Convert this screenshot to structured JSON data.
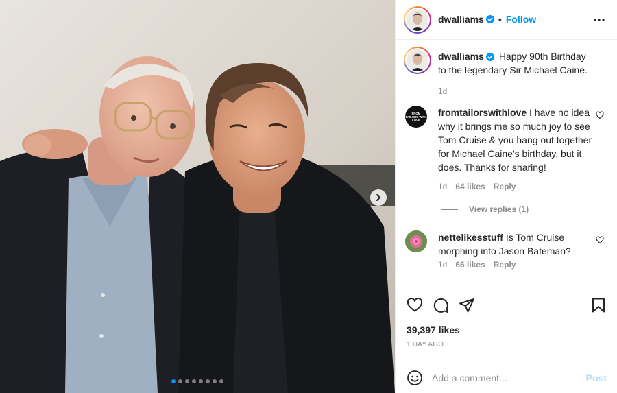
{
  "header": {
    "username": "dwalliams",
    "separator": "•",
    "follow_label": "Follow"
  },
  "caption": {
    "username": "dwalliams",
    "text": "Happy 90th Birthday to the legendary Sir Michael Caine.",
    "time": "1d"
  },
  "comments": [
    {
      "username": "fromtailorswithlove",
      "avatar_text": "FROM TAILORS WITH LOVE",
      "text": "I have no idea why it brings me so much joy to see Tom Cruise & you hang out together for Michael Caine's birthday, but it does. Thanks for sharing!",
      "time": "1d",
      "likes": "64 likes",
      "reply_label": "Reply",
      "view_replies": "View replies (1)"
    },
    {
      "username": "nettelikesstuff",
      "text": "Is Tom Cruise morphing into Jason Bateman?",
      "time": "1d",
      "likes": "66 likes",
      "reply_label": "Reply"
    }
  ],
  "stats": {
    "likes": "39,397 likes",
    "date": "1 DAY AGO"
  },
  "add_comment": {
    "placeholder": "Add a comment...",
    "post_label": "Post"
  },
  "carousel": {
    "count": 8,
    "active_index": 0
  },
  "icons": [
    "verified-badge-icon",
    "more-options-icon",
    "heart-icon",
    "comment-icon",
    "share-icon",
    "save-icon",
    "emoji-icon",
    "chevron-right-icon"
  ],
  "colors": {
    "accent": "#0095f6",
    "text": "#262626",
    "muted": "#8e8e8e",
    "post_disabled": "#b2dffc"
  }
}
